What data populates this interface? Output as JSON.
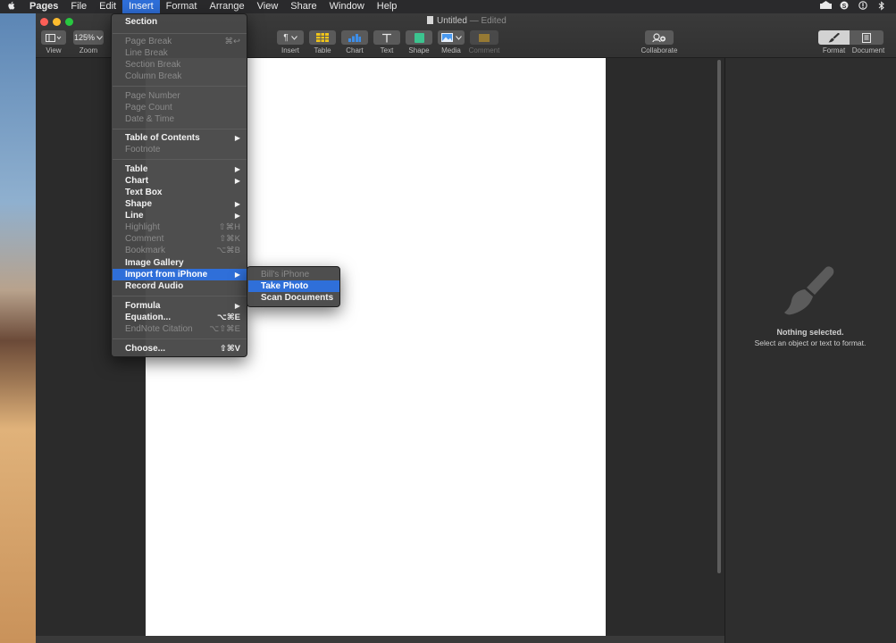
{
  "menubar": {
    "apple": "",
    "items": [
      "Pages",
      "File",
      "Edit",
      "Insert",
      "Format",
      "Arrange",
      "View",
      "Share",
      "Window",
      "Help"
    ],
    "status_icons": [
      "display-icon",
      "skype-icon",
      "info-icon",
      "bluetooth-icon"
    ]
  },
  "window": {
    "title": "Untitled",
    "title_suffix": "— Edited"
  },
  "toolbar": {
    "view_label": "View",
    "zoom_value": "125%",
    "zoom_label": "Zoom",
    "insert_label": "Insert",
    "table_label": "Table",
    "chart_label": "Chart",
    "text_label": "Text",
    "shape_label": "Shape",
    "media_label": "Media",
    "comment_label": "Comment",
    "collaborate_label": "Collaborate",
    "format_label": "Format",
    "document_label": "Document"
  },
  "insert_menu": {
    "section": "Section",
    "page_break": "Page Break",
    "page_break_sc": "⌘↩",
    "line_break": "Line Break",
    "section_break": "Section Break",
    "column_break": "Column Break",
    "page_number": "Page Number",
    "page_count": "Page Count",
    "date_time": "Date & Time",
    "toc": "Table of Contents",
    "footnote": "Footnote",
    "table": "Table",
    "chart": "Chart",
    "text_box": "Text Box",
    "shape": "Shape",
    "line": "Line",
    "highlight": "Highlight",
    "highlight_sc": "⇧⌘H",
    "comment": "Comment",
    "comment_sc": "⇧⌘K",
    "bookmark": "Bookmark",
    "bookmark_sc": "⌥⌘B",
    "image_gallery": "Image Gallery",
    "import_iphone": "Import from iPhone",
    "record_audio": "Record Audio",
    "formula": "Formula",
    "equation": "Equation...",
    "equation_sc": "⌥⌘E",
    "endnote": "EndNote Citation",
    "endnote_sc": "⌥⇧⌘E",
    "choose": "Choose...",
    "choose_sc": "⇧⌘V",
    "arrow": "▶"
  },
  "iphone_submenu": {
    "device": "Bill's iPhone",
    "take_photo": "Take Photo",
    "scan_documents": "Scan Documents"
  },
  "inspector": {
    "nothing_selected": "Nothing selected.",
    "hint": "Select an object or text to format."
  }
}
